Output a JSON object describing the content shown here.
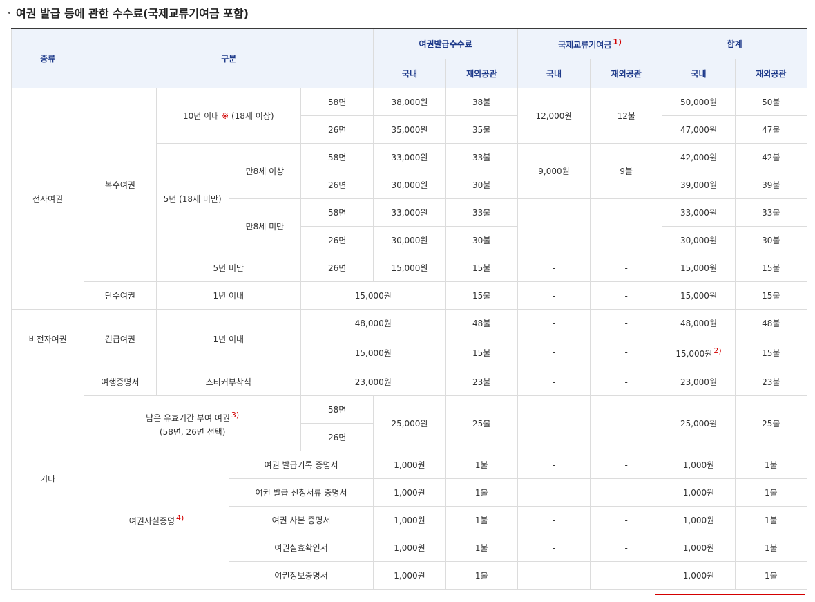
{
  "title": "여권 발급 등에 관한 수수료(국제교류기여금 포함)",
  "header": {
    "kind": "종류",
    "category": "구분",
    "issue_fee": "여권발급수수료",
    "contribution": "국제교류기여금",
    "contribution_note": "1)",
    "total": "합계",
    "domestic": "국내",
    "overseas": "재외공관"
  },
  "groups": {
    "electronic": "전자여권",
    "multiple": "복수여권",
    "ten_years": "10년 이내",
    "ten_years_mark": "※",
    "ten_years_age": "(18세 이상)",
    "five_years": "5년 (18세 미만)",
    "over8": "만8세 이상",
    "under8": "만8세 미만",
    "under5": "5년 미만",
    "single": "단수여권",
    "within1": "1년 이내",
    "non_electronic": "비전자여권",
    "emergency": "긴급여권",
    "within1b": "1년 이내",
    "other": "기타",
    "travel_cert": "여행증명서",
    "sticker": "스티커부착식",
    "remaining_line1": "남은 유효기간 부여 여권",
    "remaining_note": "3)",
    "remaining_line2": "(58면, 26면 선택)",
    "proof": "여권사실증명",
    "proof_note": "4)"
  },
  "rows": {
    "r1": {
      "pages": "58면",
      "fee": "38,000원",
      "fee_o": "38불",
      "con": "12,000원",
      "con_o": "12불",
      "tot": "50,000원",
      "tot_o": "50불"
    },
    "r2": {
      "pages": "26면",
      "fee": "35,000원",
      "fee_o": "35불",
      "tot": "47,000원",
      "tot_o": "47불"
    },
    "r3": {
      "pages": "58면",
      "fee": "33,000원",
      "fee_o": "33불",
      "con": "9,000원",
      "con_o": "9불",
      "tot": "42,000원",
      "tot_o": "42불"
    },
    "r4": {
      "pages": "26면",
      "fee": "30,000원",
      "fee_o": "30불",
      "tot": "39,000원",
      "tot_o": "39불"
    },
    "r5": {
      "pages": "58면",
      "fee": "33,000원",
      "fee_o": "33불",
      "con": "-",
      "con_o": "-",
      "tot": "33,000원",
      "tot_o": "33불"
    },
    "r6": {
      "pages": "26면",
      "fee": "30,000원",
      "fee_o": "30불",
      "tot": "30,000원",
      "tot_o": "30불"
    },
    "r7": {
      "pages": "26면",
      "fee": "15,000원",
      "fee_o": "15불",
      "con": "-",
      "con_o": "-",
      "tot": "15,000원",
      "tot_o": "15불"
    },
    "r8": {
      "fee": "15,000원",
      "fee_o": "15불",
      "con": "-",
      "con_o": "-",
      "tot": "15,000원",
      "tot_o": "15불"
    },
    "r9": {
      "fee": "48,000원",
      "fee_o": "48불",
      "con": "-",
      "con_o": "-",
      "tot": "48,000원",
      "tot_o": "48불"
    },
    "r10": {
      "fee": "15,000원",
      "fee_o": "15불",
      "con": "-",
      "con_o": "-",
      "tot": "15,000원",
      "tot_note": "2)",
      "tot_o": "15불"
    },
    "r11": {
      "fee": "23,000원",
      "fee_o": "23불",
      "con": "-",
      "con_o": "-",
      "tot": "23,000원",
      "tot_o": "23불"
    },
    "r12": {
      "pages1": "58면",
      "pages2": "26면",
      "fee": "25,000원",
      "fee_o": "25불",
      "con": "-",
      "con_o": "-",
      "tot": "25,000원",
      "tot_o": "25불"
    }
  },
  "proof_rows": [
    {
      "label": "여권 발급기록 증명서",
      "fee": "1,000원",
      "fee_o": "1불",
      "con": "-",
      "con_o": "-",
      "tot": "1,000원",
      "tot_o": "1불"
    },
    {
      "label": "여권 발급 신청서류 증명서",
      "fee": "1,000원",
      "fee_o": "1불",
      "con": "-",
      "con_o": "-",
      "tot": "1,000원",
      "tot_o": "1불"
    },
    {
      "label": "여권 사본 증명서",
      "fee": "1,000원",
      "fee_o": "1불",
      "con": "-",
      "con_o": "-",
      "tot": "1,000원",
      "tot_o": "1불"
    },
    {
      "label": "여권실효확인서",
      "fee": "1,000원",
      "fee_o": "1불",
      "con": "-",
      "con_o": "-",
      "tot": "1,000원",
      "tot_o": "1불"
    },
    {
      "label": "여권정보증명서",
      "fee": "1,000원",
      "fee_o": "1불",
      "con": "-",
      "con_o": "-",
      "tot": "1,000원",
      "tot_o": "1불"
    }
  ]
}
